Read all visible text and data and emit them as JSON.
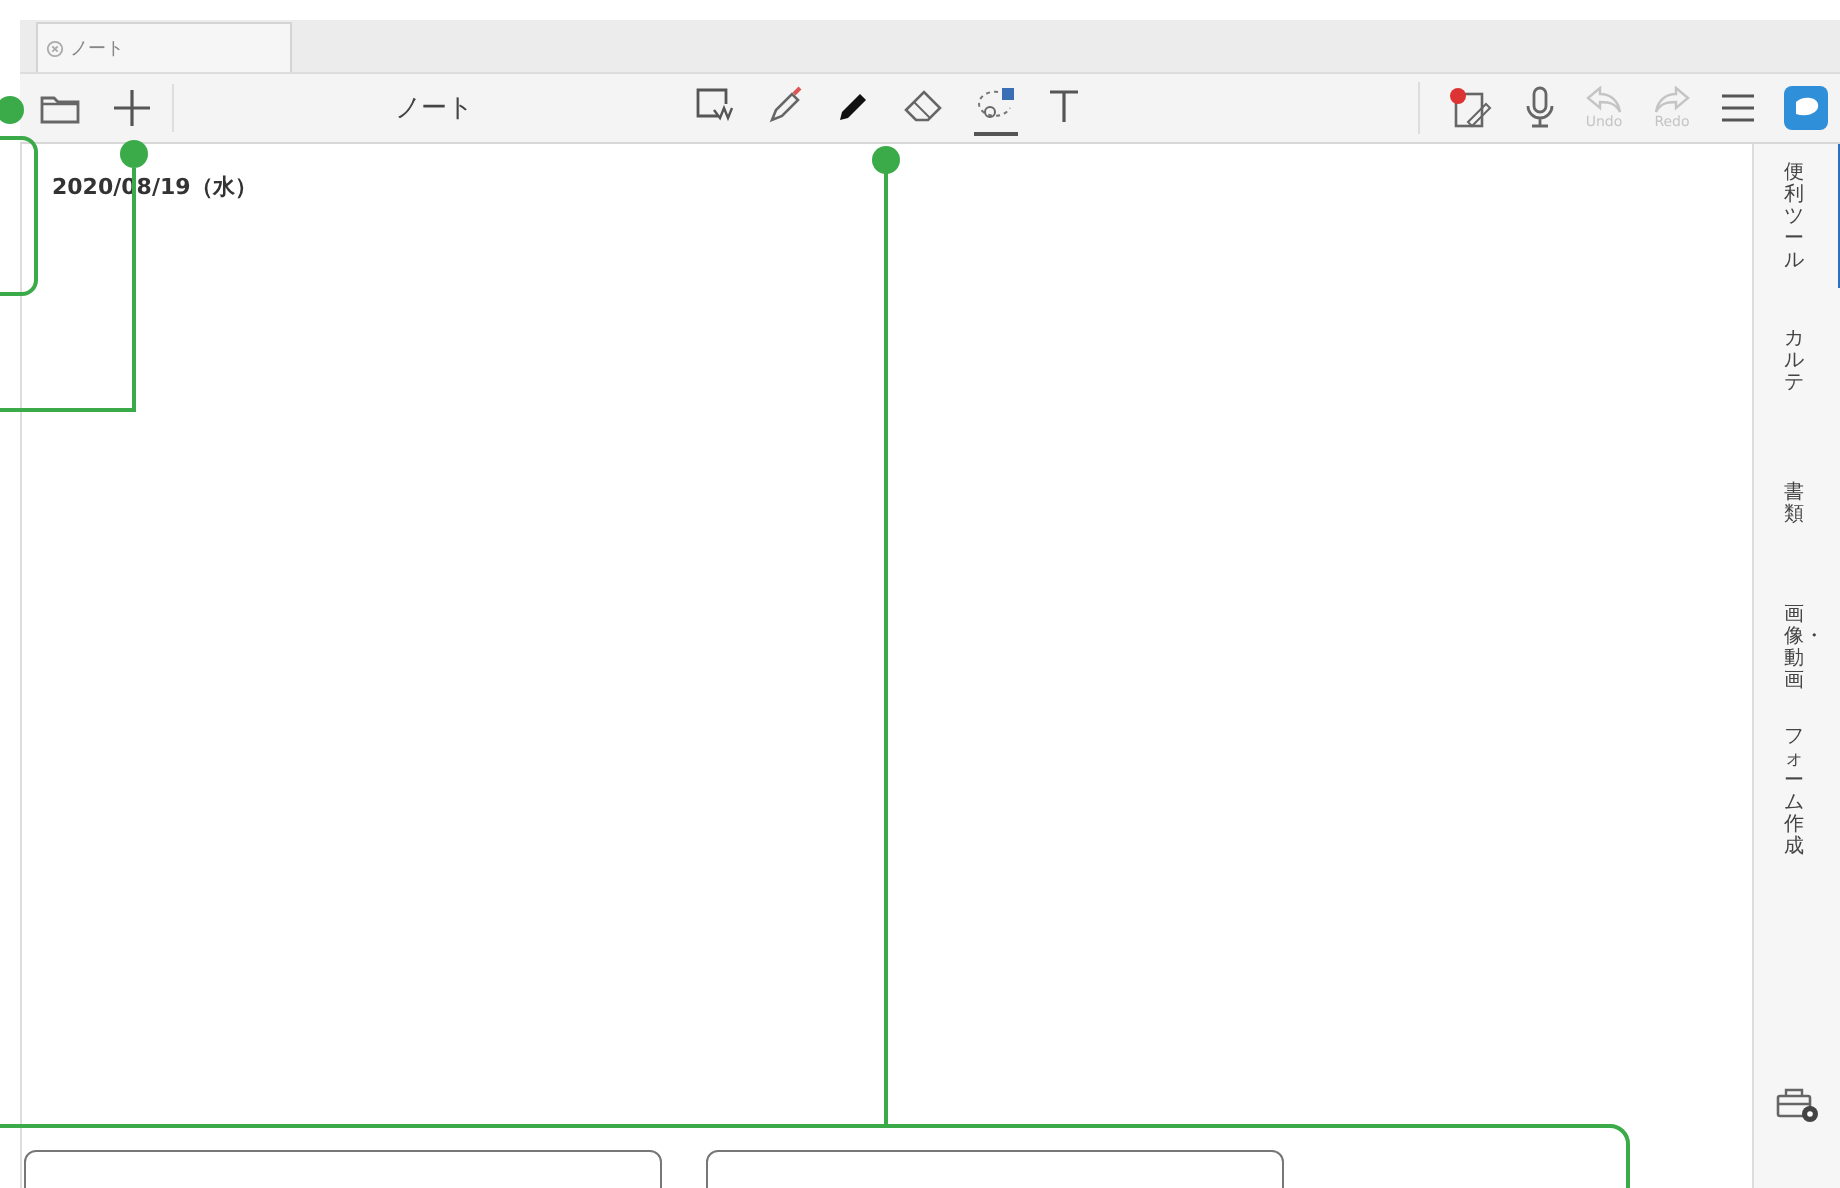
{
  "tab": {
    "label": "ノート",
    "selected": true
  },
  "toolbar": {
    "title": "ノート",
    "left": [
      {
        "kind": "folder"
      },
      {
        "kind": "plus"
      }
    ],
    "tools": [
      {
        "kind": "select",
        "selected": false
      },
      {
        "kind": "marker",
        "selected": false
      },
      {
        "kind": "pen",
        "selected": false
      },
      {
        "kind": "eraser",
        "selected": false
      },
      {
        "kind": "lasso",
        "selected": true
      },
      {
        "kind": "text",
        "selected": false
      }
    ],
    "right": [
      {
        "kind": "pages",
        "badge": true
      },
      {
        "kind": "mic"
      },
      {
        "kind": "undo",
        "label": "Undo",
        "disabled": true
      },
      {
        "kind": "redo",
        "label": "Redo",
        "disabled": true
      },
      {
        "kind": "menu"
      },
      {
        "kind": "app"
      }
    ]
  },
  "date": "2020/08/19（水）",
  "side_tabs": [
    {
      "label": "便利ツール",
      "selected": true
    },
    {
      "label": "カルテ",
      "selected": false
    },
    {
      "label": "書類",
      "selected": false
    },
    {
      "label": "画像・動画",
      "selected": false
    },
    {
      "label": "フォーム作成",
      "selected": false
    }
  ]
}
